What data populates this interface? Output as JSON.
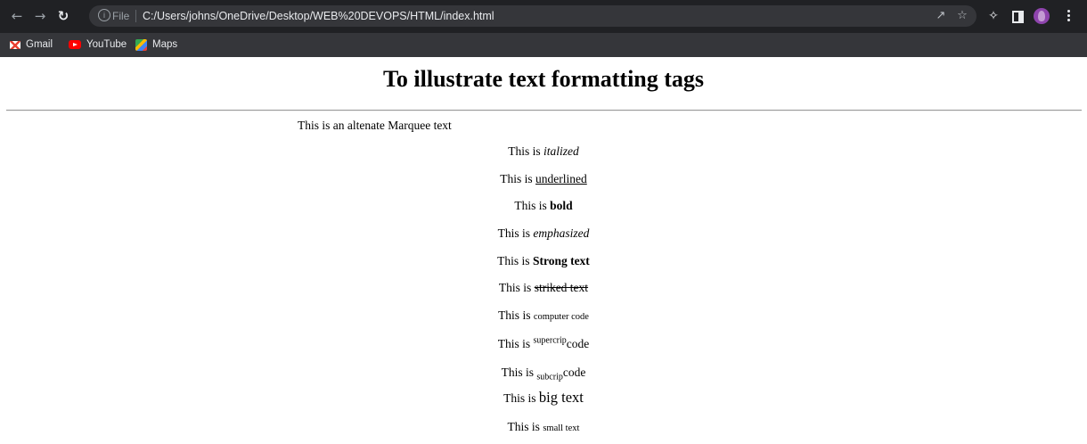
{
  "browser": {
    "url_scheme": "File",
    "url": "C:/Users/johns/OneDrive/Desktop/WEB%20DEVOPS/HTML/index.html",
    "info_glyph": "i",
    "icons": [
      "back-icon",
      "forward-icon",
      "reload-icon",
      "info-icon",
      "share-icon",
      "bookmark-star-icon",
      "extensions-icon",
      "side-panel-icon",
      "profile-avatar",
      "menu-icon"
    ]
  },
  "bookmarks": [
    {
      "label": "Gmail",
      "icon": "gmail-icon"
    },
    {
      "label": "YouTube",
      "icon": "youtube-icon"
    },
    {
      "label": "Maps",
      "icon": "maps-icon"
    }
  ],
  "page": {
    "heading": "To illustrate text formatting tags",
    "marquee_text": "This is an altenate Marquee text",
    "lines": [
      {
        "prefix": "This is ",
        "styled": "italized",
        "suffix": ""
      },
      {
        "prefix": "This is ",
        "styled": "underlined",
        "suffix": ""
      },
      {
        "prefix": "This is ",
        "styled": "bold",
        "suffix": ""
      },
      {
        "prefix": "This is ",
        "styled": "emphasized",
        "suffix": ""
      },
      {
        "prefix": "This is ",
        "styled": "Strong text",
        "suffix": ""
      },
      {
        "prefix": "This is ",
        "styled": "striked text",
        "suffix": ""
      },
      {
        "prefix": "This is ",
        "styled": "computer code",
        "suffix": ""
      },
      {
        "prefix": "This is ",
        "styled": "supercrip",
        "suffix": "code"
      },
      {
        "prefix": "This is ",
        "styled": "subcrip",
        "suffix": "code"
      },
      {
        "prefix": "This is ",
        "styled": "big text",
        "suffix": ""
      },
      {
        "prefix": "This is ",
        "styled": "small text",
        "suffix": ""
      }
    ]
  },
  "colors": {
    "toolbar_bg": "#202124",
    "omnibox_bg": "#35363a",
    "bookmarks_bg": "#35363a",
    "page_bg": "#ffffff"
  }
}
